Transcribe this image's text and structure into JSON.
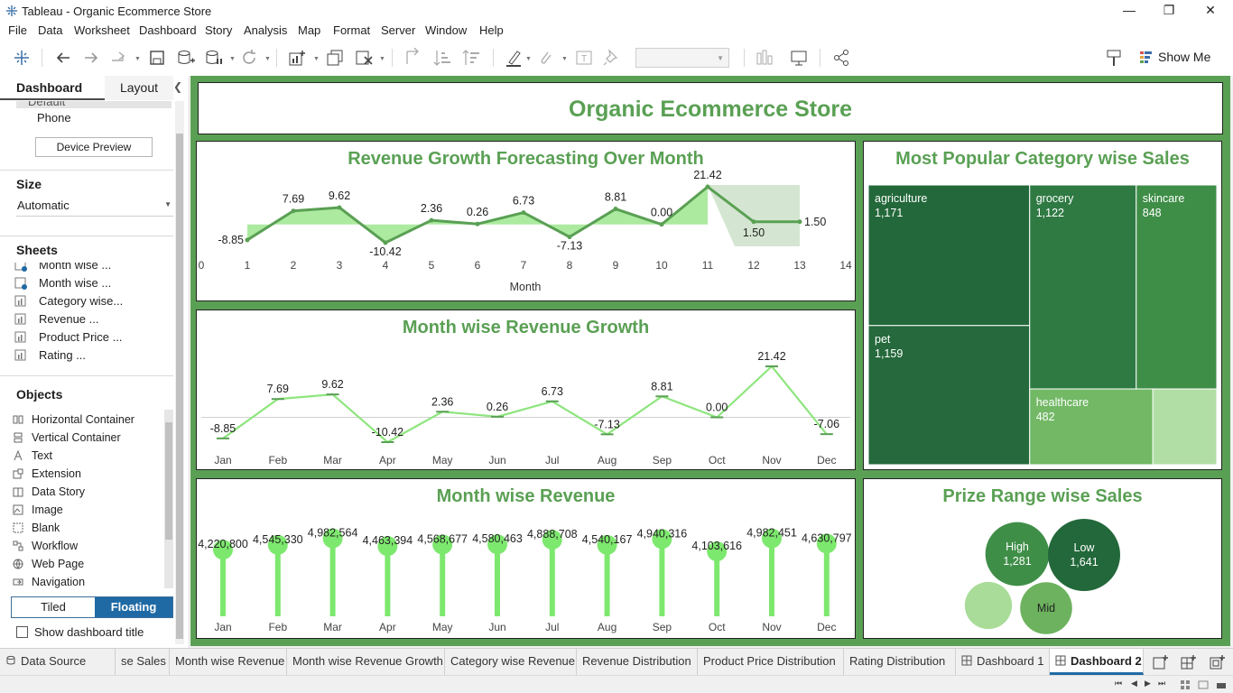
{
  "window": {
    "title": "Tableau - Organic Ecommerce Store",
    "minimize_glyph": "—",
    "restore_glyph": "❐",
    "close_glyph": "✕"
  },
  "menu": [
    "File",
    "Data",
    "Worksheet",
    "Dashboard",
    "Story",
    "Analysis",
    "Map",
    "Format",
    "Server",
    "Window",
    "Help"
  ],
  "toolbar": {
    "icons": [
      "tableau-logo-icon",
      "undo-icon",
      "redo-icon",
      "replay-icon",
      "save-icon",
      "new-data-source-icon",
      "pause-updates-icon",
      "refresh-icon",
      "new-worksheet-icon",
      "duplicate-icon",
      "clear-sheet-icon",
      "swap-icon",
      "sort-ascending-icon",
      "sort-descending-icon",
      "highlight-icon",
      "group-icon",
      "show-labels-icon",
      "pin-icon",
      "show-cards-icon",
      "presentation-icon",
      "share-icon",
      "format-painter-icon",
      "show-me-icon"
    ],
    "show_me": "Show Me"
  },
  "left_pane": {
    "tabs": {
      "dashboard": "Dashboard",
      "layout": "Layout"
    },
    "device_partial": "Default",
    "device_phone": "Phone",
    "device_preview_button": "Device Preview",
    "size_title": "Size",
    "size_value": "Automatic",
    "sheets_title": "Sheets",
    "sheets": [
      "Month wise ...",
      "Month wise ...",
      "Category wise...",
      "Revenue ...",
      "Product Price ...",
      "Rating ..."
    ],
    "objects_title": "Objects",
    "objects": [
      {
        "label": "Horizontal Container",
        "icon": "horizontal-container-icon"
      },
      {
        "label": "Vertical Container",
        "icon": "vertical-container-icon"
      },
      {
        "label": "Text",
        "icon": "text-icon"
      },
      {
        "label": "Extension",
        "icon": "extension-icon"
      },
      {
        "label": "Data Story",
        "icon": "data-story-icon"
      },
      {
        "label": "Image",
        "icon": "image-icon"
      },
      {
        "label": "Blank",
        "icon": "blank-icon"
      },
      {
        "label": "Workflow",
        "icon": "workflow-icon"
      },
      {
        "label": "Web Page",
        "icon": "web-page-icon"
      },
      {
        "label": "Navigation",
        "icon": "navigation-icon"
      }
    ],
    "tiled": "Tiled",
    "floating": "Floating",
    "show_dashboard_title": "Show dashboard title"
  },
  "dashboard": {
    "title": "Organic Ecommerce Store",
    "accent_color": "#5aa054",
    "background_color": "#5aa054"
  },
  "chart_data": [
    {
      "id": "forecast",
      "type": "line",
      "title": "Revenue Growth Forecasting Over Month",
      "xlabel": "Month",
      "ylabel": "",
      "x_ticks": [
        0,
        1,
        2,
        3,
        4,
        5,
        6,
        7,
        8,
        9,
        10,
        11,
        12,
        13,
        14
      ],
      "xlim": [
        0,
        14
      ],
      "series": [
        {
          "x": [
            1,
            2,
            3,
            4,
            5,
            6,
            7,
            8,
            9,
            10,
            11,
            12,
            13
          ],
          "values": [
            -8.85,
            7.69,
            9.62,
            -10.42,
            2.36,
            0.26,
            6.73,
            -7.13,
            8.81,
            0.0,
            21.42,
            1.5,
            1.5
          ]
        }
      ],
      "data_labels": [
        "-8.85",
        "7.69",
        "9.62",
        "-10.42",
        "2.36",
        "0.26",
        "6.73",
        "-7.13",
        "8.81",
        "0.00",
        "21.42",
        "1.50",
        "1.50"
      ],
      "forecast_start_x": 11,
      "colors": {
        "line": "#5aa054",
        "band": "#9ee68f",
        "forecast_band": "#cfe3cc"
      }
    },
    {
      "id": "growth",
      "type": "line",
      "title": "Month wise Revenue Growth",
      "categories": [
        "Jan",
        "Feb",
        "Mar",
        "Apr",
        "May",
        "Jun",
        "Jul",
        "Aug",
        "Sep",
        "Oct",
        "Nov",
        "Dec"
      ],
      "values": [
        -8.85,
        7.69,
        9.62,
        -10.42,
        2.36,
        0.26,
        6.73,
        -7.13,
        8.81,
        0.0,
        21.42,
        -7.06
      ],
      "data_labels": [
        "-8.85",
        "7.69",
        "9.62",
        "-10.42",
        "2.36",
        "0.26",
        "6.73",
        "-7.13",
        "8.81",
        "0.00",
        "21.42",
        "-7.06"
      ],
      "colors": {
        "line": "#8ee67e",
        "marker": "#5aa054"
      }
    },
    {
      "id": "revenue",
      "type": "bar",
      "title": "Month wise Revenue",
      "categories": [
        "Jan",
        "Feb",
        "Mar",
        "Apr",
        "May",
        "Jun",
        "Jul",
        "Aug",
        "Sep",
        "Oct",
        "Nov",
        "Dec"
      ],
      "values": [
        4220800,
        4545330,
        4982564,
        4463394,
        4568677,
        4580463,
        4888708,
        4540167,
        4940316,
        4103616,
        4982451,
        4630797
      ],
      "data_labels": [
        "4,220,800",
        "4,545,330",
        "4,982,564",
        "4,463,394",
        "4,568,677",
        "4,580,463",
        "4,888,708",
        "4,540,167",
        "4,940,316",
        "4,103,616",
        "4,982,451",
        "4,630,797"
      ],
      "colors": {
        "bar": "#7de86e"
      }
    },
    {
      "id": "category",
      "type": "treemap",
      "title": "Most Popular Category wise Sales",
      "items": [
        {
          "name": "agriculture",
          "value": 1171,
          "label": "1,171",
          "color": "#23683a"
        },
        {
          "name": "pet",
          "value": 1159,
          "label": "1,159",
          "color": "#25693c"
        },
        {
          "name": "grocery",
          "value": 1122,
          "label": "1,122",
          "color": "#2f7a43"
        },
        {
          "name": "skincare",
          "value": 848,
          "label": "848",
          "color": "#3f8e48"
        },
        {
          "name": "healthcare",
          "value": 482,
          "label": "482",
          "color": "#72b865"
        },
        {
          "name": "",
          "value": 250,
          "label": "",
          "color": "#b1dea4"
        }
      ]
    },
    {
      "id": "prize",
      "type": "bubble",
      "title": "Prize Range wise Sales",
      "items": [
        {
          "name": "High",
          "value": 1281,
          "label": "1,281",
          "color": "#3f8e48"
        },
        {
          "name": "Low",
          "value": 1641,
          "label": "1,641",
          "color": "#23683a"
        },
        {
          "name": "",
          "value": 700,
          "label": "",
          "color": "#a8dc98"
        },
        {
          "name": "Mid",
          "value": 850,
          "label": "",
          "color": "#6db25e"
        }
      ]
    }
  ],
  "tabs": [
    {
      "label": "Data Source",
      "icon": "data-source-icon"
    },
    {
      "label": "se Sales",
      "icon": ""
    },
    {
      "label": "Month wise Revenue",
      "icon": ""
    },
    {
      "label": "Month wise Revenue Growth",
      "icon": ""
    },
    {
      "label": "Category wise Revenue",
      "icon": ""
    },
    {
      "label": "Revenue Distribution",
      "icon": ""
    },
    {
      "label": "Product Price Distribution",
      "icon": ""
    },
    {
      "label": "Rating Distribution",
      "icon": ""
    },
    {
      "label": "Dashboard 1",
      "icon": "dashboard-icon"
    },
    {
      "label": "Dashboard 2",
      "icon": "dashboard-icon",
      "active": true
    }
  ],
  "tab_actions": [
    "new-worksheet-icon",
    "new-dashboard-icon",
    "new-story-icon"
  ],
  "status_nav": [
    "⏮",
    "◀",
    "▶",
    "⏭"
  ]
}
